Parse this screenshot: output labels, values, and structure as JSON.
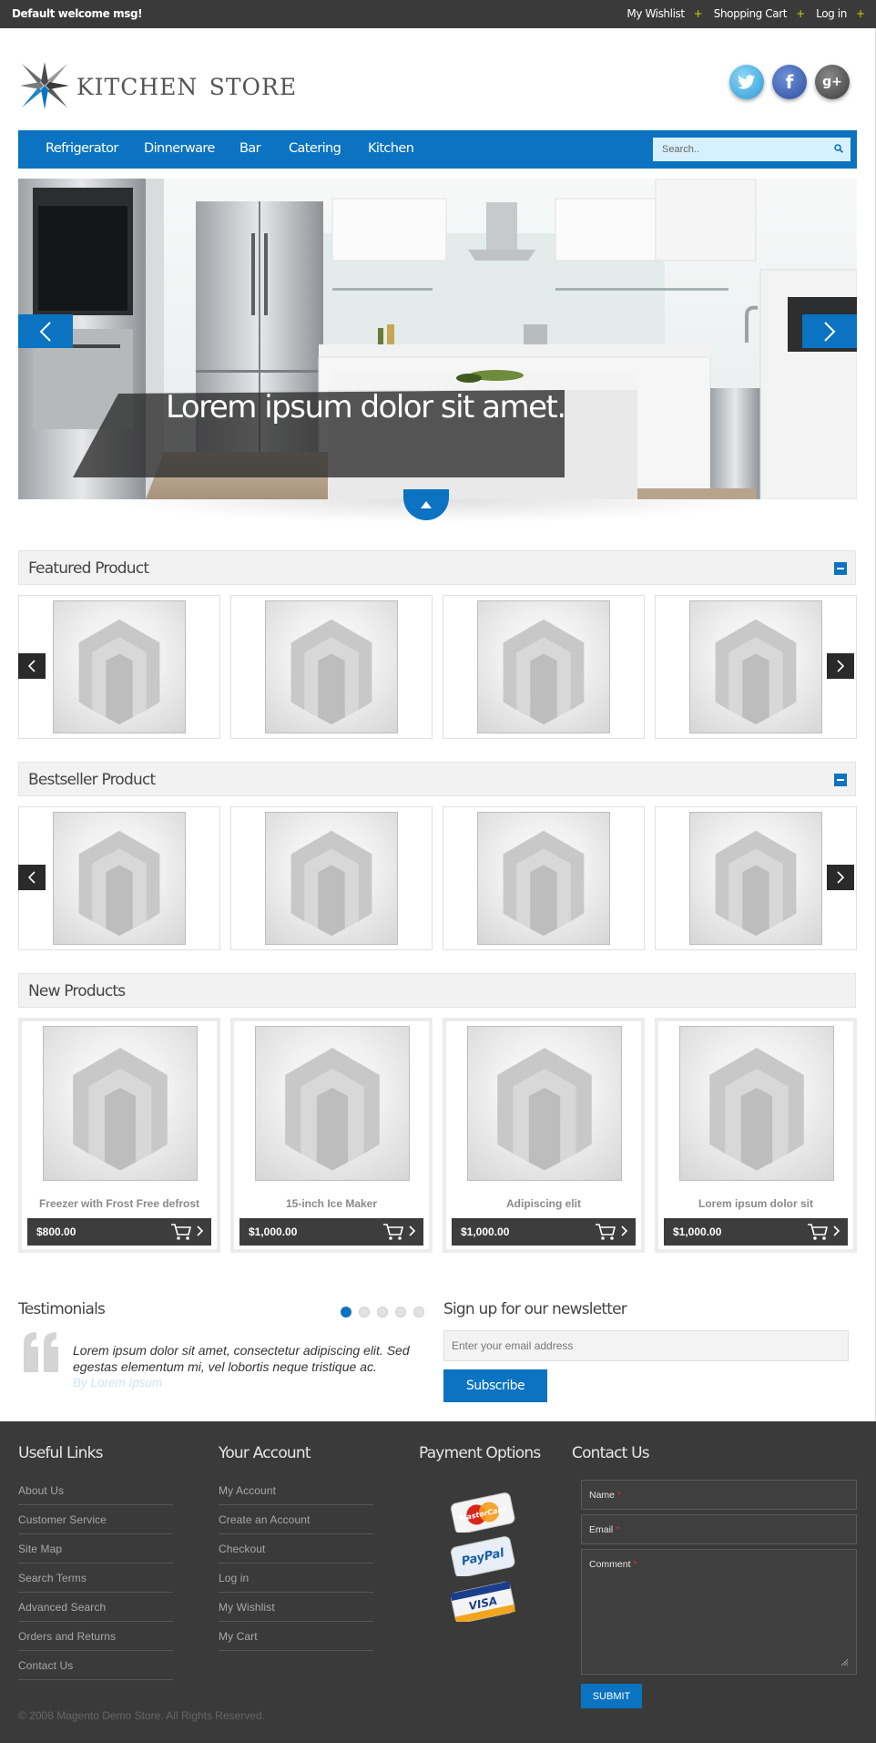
{
  "topbar": {
    "welcome": "Default welcome msg!",
    "links": [
      "My Wishlist",
      "Shopping Cart",
      "Log in"
    ],
    "separator": "+"
  },
  "header": {
    "logo_text": "kitchen store",
    "social": [
      "twitter-icon",
      "facebook-icon",
      "google-plus-icon"
    ],
    "social_labels": {
      "facebook": "f",
      "google": "g+"
    }
  },
  "nav": {
    "items": [
      "Refrigerator",
      "Dinnerware",
      "Bar",
      "Catering",
      "Kitchen"
    ],
    "search_placeholder": "Search.."
  },
  "slider": {
    "caption": "Lorem ipsum dolor sit amet."
  },
  "sections": {
    "featured": "Featured Product",
    "bestseller": "Bestseller Product",
    "new": "New Products"
  },
  "new_products": [
    {
      "name": "Freezer with Frost Free defrost",
      "price": "$800.00"
    },
    {
      "name": "15-inch Ice Maker",
      "price": "$1,000.00"
    },
    {
      "name": "Adipiscing elit",
      "price": "$1,000.00"
    },
    {
      "name": "Lorem ipsum dolor sit",
      "price": "$1,000.00"
    }
  ],
  "testimonials": {
    "title": "Testimonials",
    "text": "Lorem ipsum dolor sit amet, consectetur adipiscing elit. Sed egestas elementum mi, vel lobortis neque tristique ac.",
    "by": "By Lorem Ipsum",
    "dots": 5,
    "active_dot": 0
  },
  "newsletter": {
    "title": "Sign up for our newsletter",
    "placeholder": "Enter your email address",
    "button": "Subscribe"
  },
  "footer": {
    "useful_links": {
      "title": "Useful Links",
      "items": [
        "About Us",
        "Customer Service",
        "Site Map",
        "Search Terms",
        "Advanced Search",
        "Orders and Returns",
        "Contact Us"
      ]
    },
    "your_account": {
      "title": "Your Account",
      "items": [
        "My Account",
        "Create an Account",
        "Checkout",
        "Log in",
        "My Wishlist",
        "My Cart"
      ]
    },
    "payment": {
      "title": "Payment Options",
      "cards": [
        "MasterCard",
        "PayPal",
        "VISA"
      ]
    },
    "contact": {
      "title": "Contact Us",
      "name_label": "Name",
      "email_label": "Email",
      "comment_label": "Comment",
      "required_mark": "*",
      "submit": "SUBMIT"
    },
    "copyright": "© 2008 Magento Demo Store. All Rights Reserved."
  },
  "colors": {
    "accent": "#0b73c1",
    "topbar": "#3a3a3a",
    "footer": "#3a3a3a"
  }
}
